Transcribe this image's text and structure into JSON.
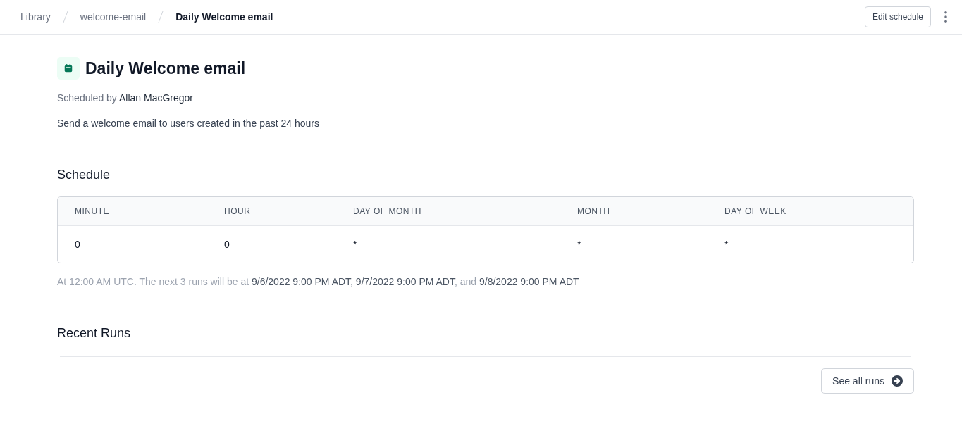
{
  "breadcrumbs": [
    {
      "label": "Library",
      "current": false
    },
    {
      "label": "welcome-email",
      "current": false
    },
    {
      "label": "Daily Welcome email",
      "current": true
    }
  ],
  "header_actions": {
    "edit_button": "Edit schedule"
  },
  "title": "Daily Welcome email",
  "scheduled_by": {
    "label": "Scheduled by",
    "name": "Allan MacGregor"
  },
  "description": "Send a welcome email to users created in the past 24 hours",
  "schedule": {
    "heading": "Schedule",
    "table": {
      "columns": [
        "MINUTE",
        "HOUR",
        "DAY OF MONTH",
        "MONTH",
        "DAY OF WEEK"
      ],
      "rows": [
        [
          "0",
          "0",
          "*",
          "*",
          "*"
        ]
      ]
    },
    "next_runs": "At 12:00 AM UTC. The next 3 runs will be at **9/6/2022 9:00 PM ADT**, **9/7/2022 9:00 PM ADT**, and **9/8/2022 9:00 PM ADT**"
  },
  "recent_runs": {
    "heading": "Recent Runs",
    "see_all_button": "See all runs"
  }
}
